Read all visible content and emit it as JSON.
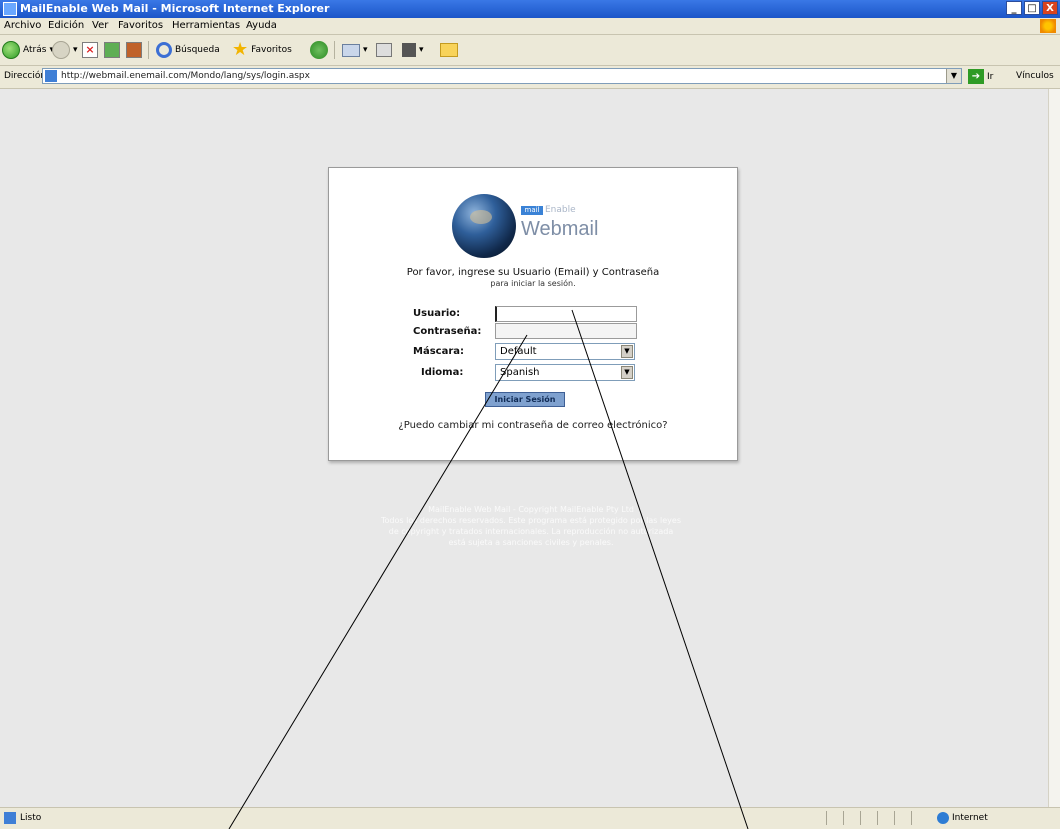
{
  "window": {
    "title": "MailEnable Web Mail - Microsoft Internet Explorer",
    "buttons": [
      "_",
      "□",
      "X"
    ]
  },
  "menu": [
    "Archivo",
    "Edición",
    "Ver",
    "Favoritos",
    "Herramientas",
    "Ayuda"
  ],
  "toolbar": {
    "back_label": "Atrás",
    "search_label": "Búsqueda",
    "favorites_label": "Favoritos"
  },
  "address": {
    "label": "Dirección",
    "url": "http://webmail.enemail.com/Mondo/lang/sys/login.aspx",
    "go_label": "Ir",
    "links_label": "Vínculos"
  },
  "logo": {
    "mail": "mail",
    "enable": "Enable",
    "webmail": "Webmail"
  },
  "login": {
    "intro_line1": "Por favor, ingrese su Usuario (Email) y Contraseña",
    "intro_line2": "para iniciar la sesión.",
    "usuario_label": "Usuario:",
    "contrasena_label": "Contraseña:",
    "mascara_label": "Máscara:",
    "mascara_value": "Default",
    "idioma_label": "Idioma:",
    "idioma_value": "Spanish",
    "submit": "Iniciar Sesión",
    "help_link": "¿Puedo cambiar mi contraseña de correo electrónico?"
  },
  "footer": {
    "line1": "MailEnable Web Mail - Copyright MailEnable Pty Ltd",
    "line2": "Todos los derechos reservados. Este programa está protegido por las leyes",
    "line3": "de copyright y tratados internacionales. La reproducción no autorizada",
    "line4": "está sujeta a sanciones civiles y penales."
  },
  "status": {
    "text": "Listo",
    "zone": "Internet"
  }
}
